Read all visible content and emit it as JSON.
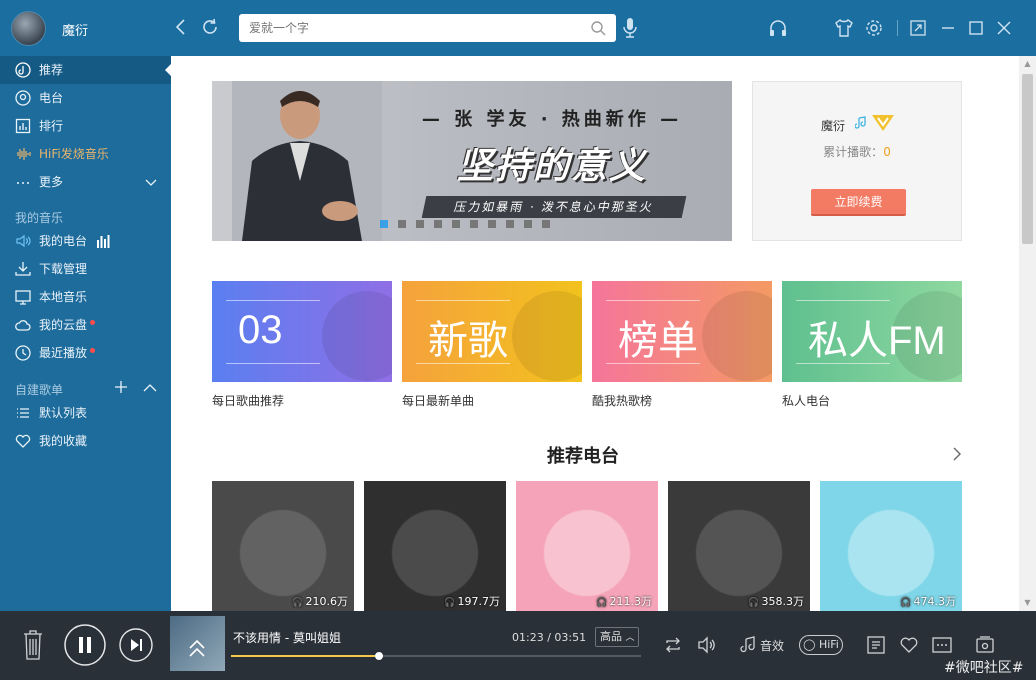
{
  "header": {
    "username": "魔衍",
    "search_placeholder": "爱就一个字"
  },
  "sidebar": {
    "items": [
      {
        "label": "推荐",
        "icon": "music-disc-icon",
        "active": true
      },
      {
        "label": "电台",
        "icon": "radio-icon"
      },
      {
        "label": "排行",
        "icon": "chart-icon"
      },
      {
        "label": "HiFi发烧音乐",
        "icon": "hifi-wave-icon"
      },
      {
        "label": "更多",
        "icon": "more-dots-icon"
      }
    ],
    "my_music_title": "我的音乐",
    "my_music": [
      {
        "label": "我的电台",
        "icon": "speaker-icon"
      },
      {
        "label": "下载管理",
        "icon": "download-icon"
      },
      {
        "label": "本地音乐",
        "icon": "monitor-icon"
      },
      {
        "label": "我的云盘",
        "icon": "cloud-icon"
      },
      {
        "label": "最近播放",
        "icon": "clock-icon"
      }
    ],
    "playlist_title": "自建歌单",
    "playlists": [
      {
        "label": "默认列表",
        "icon": "list-icon"
      },
      {
        "label": "我的收藏",
        "icon": "heart-icon"
      }
    ]
  },
  "banner": {
    "title": "— 张 学友 · 热曲新作 —",
    "headline": "坚持的意义",
    "tagline": "压力如暴雨 · 泼不息心中那圣火",
    "slide_count": 10,
    "active_slide": 0
  },
  "vip": {
    "name": "魔衍",
    "count_label": "累计播歌：",
    "count_value": "0",
    "renew_label": "立即续费"
  },
  "tiles": [
    {
      "big": "03",
      "caption": "每日歌曲推荐",
      "from": "#5a7ff0",
      "to": "#8f6fe6"
    },
    {
      "big": "新歌",
      "caption": "每日最新单曲",
      "from": "#f5a23c",
      "to": "#f2c21d"
    },
    {
      "big": "榜单",
      "caption": "酷我热歌榜",
      "from": "#f5759a",
      "to": "#f49a64"
    },
    {
      "big": "私人FM",
      "caption": "私人电台",
      "from": "#5fc08f",
      "to": "#8fd8a0"
    }
  ],
  "radio_section": {
    "title": "推荐电台",
    "cards": [
      {
        "listens": "210.6万",
        "bg": "#4a4a4a"
      },
      {
        "listens": "197.7万",
        "bg": "#2f2f2f"
      },
      {
        "listens": "211.3万",
        "bg": "#f4a3b8"
      },
      {
        "listens": "358.3万",
        "bg": "#3a3a3a"
      },
      {
        "listens": "474.3万",
        "bg": "#7fd6e8"
      }
    ]
  },
  "player": {
    "song": "不该用情 - 莫叫姐姐",
    "elapsed": "01:23",
    "total": "03:51",
    "time_sep": " / ",
    "quality": "高品",
    "progress": 0.36,
    "effects_label": "音效",
    "hifi_label": "HiFi",
    "watermark": "#微吧社区#"
  },
  "colors": {
    "topbar": "#1b6ea0",
    "sidebar": "#1e6c9c",
    "accent_red": "#f37a63",
    "player_bg": "#2a3037"
  }
}
